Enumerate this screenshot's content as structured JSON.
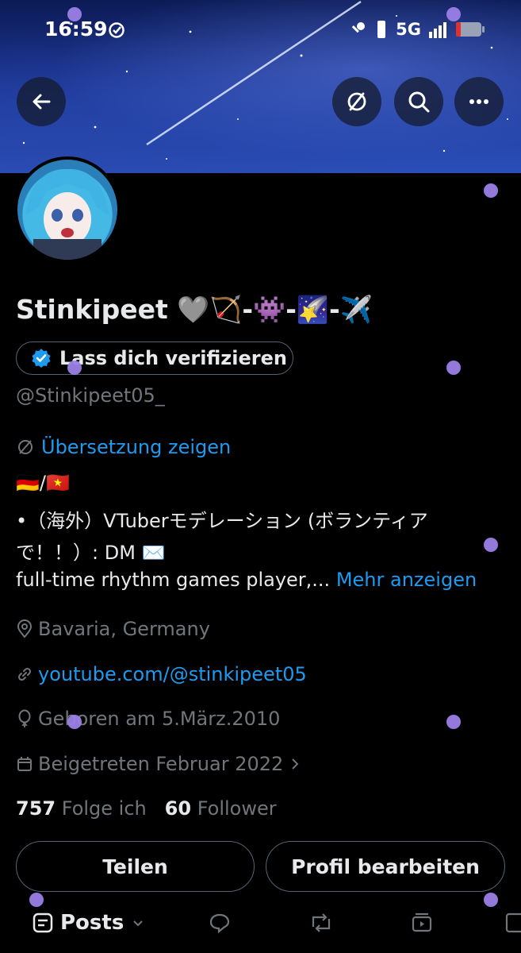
{
  "status_bar": {
    "time": "16:59",
    "network": "5G"
  },
  "header": {
    "back_icon": "arrow-left-icon",
    "translate_icon": "translate-off-icon",
    "search_icon": "search-icon",
    "more_icon": "more-horizontal-icon"
  },
  "profile": {
    "display_name": "Stinkipeet 🩶🏹-👾-🌠-✈️",
    "verify_label": "Lass dich verifizieren",
    "handle": "@Stinkipeet05_",
    "translate_label": "Übersetzung zeigen",
    "bio_flags": "🇩🇪/🇻🇳",
    "bio_line1": "•（海外）VTuberモデレーション (ボランティアで！！）: DM ✉️",
    "bio_line3": "full-time rhythm games player,...",
    "show_more": "Mehr anzeigen",
    "location": "Bavaria, Germany",
    "website": "youtube.com/@stinkipeet05",
    "birthday": "Geboren am 5.März.2010",
    "joined": "Beigetreten Februar 2022",
    "following_count": "757",
    "following_label": "Folge ich",
    "followers_count": "60",
    "followers_label": "Follower"
  },
  "actions": {
    "share_label": "Teilen",
    "edit_label": "Profil bearbeiten"
  },
  "tabs": {
    "posts_label": "Posts"
  },
  "colors": {
    "accent": "#1d9bf0",
    "muted": "#71767b",
    "text": "#e7e9ea",
    "border": "#536471"
  }
}
